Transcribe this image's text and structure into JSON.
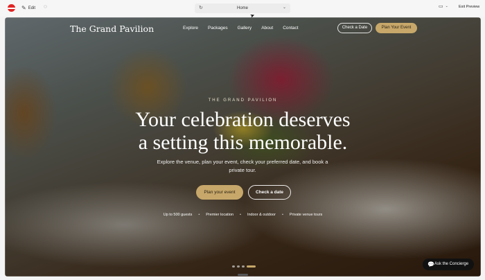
{
  "toolbar": {
    "edit_label": "Edit",
    "page_selected": "Home",
    "exit_label": "Exit Preview"
  },
  "site": {
    "brand": "The Grand Pavilion",
    "nav": [
      "Explore",
      "Packages",
      "Gallery",
      "About",
      "Contact"
    ],
    "check_date_label": "Check a Date",
    "plan_event_label": "Plan Your Event"
  },
  "hero": {
    "eyebrow": "THE GRAND PAVILION",
    "headline_line1": "Your celebration deserves",
    "headline_line2": "a setting this memorable.",
    "subtext": "Explore the venue, plan your event, check your preferred date, and book a private tour.",
    "primary_cta": "Plan your event",
    "secondary_cta": "Check a date",
    "features": [
      "Up to 500 guests",
      "Premier location",
      "Indoor & outdoor",
      "Private venue tours"
    ],
    "slides_total": 4,
    "active_slide": 4
  },
  "concierge": {
    "label": "Ask the Concierge"
  },
  "colors": {
    "gold": "#c7a86a",
    "logo_red": "#e02424"
  },
  "icons": [
    "logo-icon",
    "pencil-icon",
    "tag-icon",
    "refresh-icon",
    "chevron-down-icon",
    "monitor-icon",
    "chat-icon",
    "cursor-icon"
  ]
}
